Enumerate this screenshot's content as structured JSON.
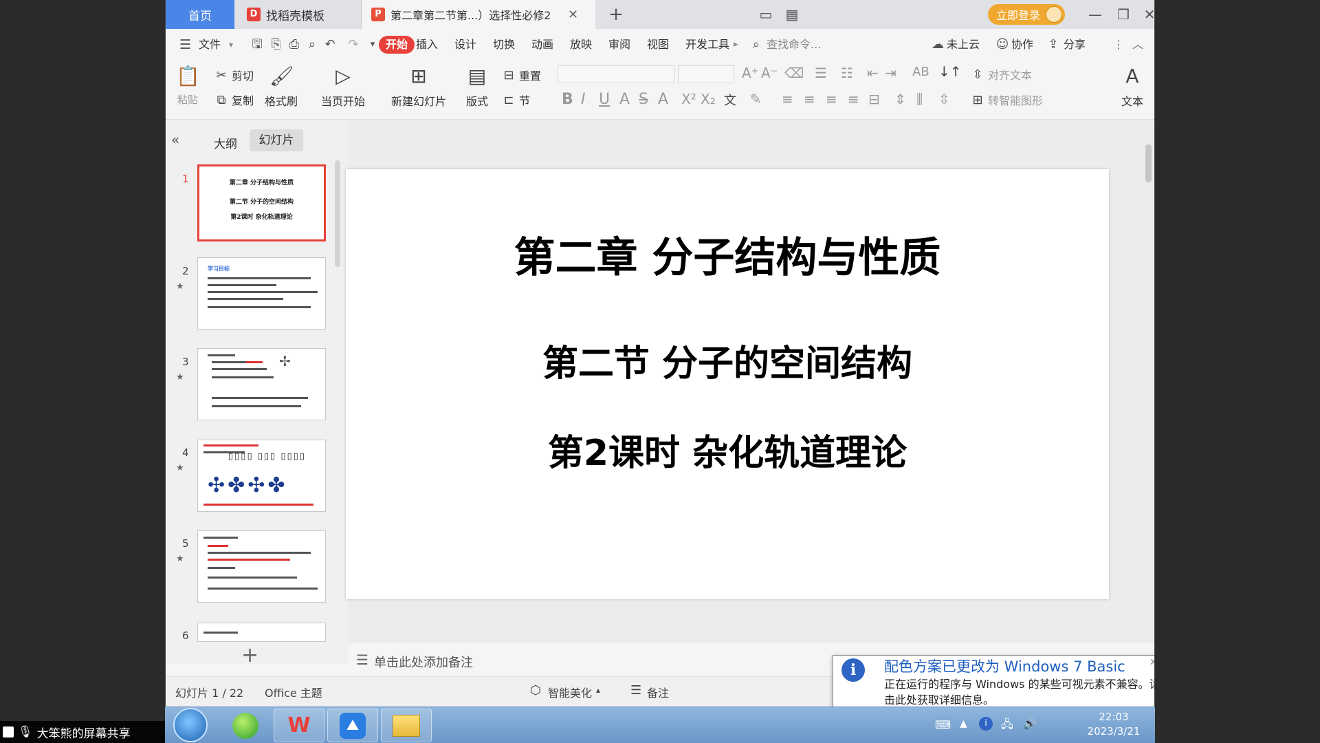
{
  "titlebar": {
    "tab_home": "首页",
    "tab_daoke": "找稻壳模板",
    "tab_doc": "第二章第二节第...）选择性必修2",
    "login": "立即登录"
  },
  "menubar": {
    "file": "文件",
    "items": [
      "开始",
      "插入",
      "设计",
      "切换",
      "动画",
      "放映",
      "审阅",
      "视图",
      "开发工具"
    ],
    "search": "查找命令...",
    "cloud": "未上云",
    "collab": "协作",
    "share": "分享"
  },
  "ribbon": {
    "paste": "粘贴",
    "cut": "剪切",
    "copy": "复制",
    "format_painter": "格式刷",
    "play_from_current": "当页开始",
    "new_slide": "新建幻灯片",
    "layout": "版式",
    "reset": "重置",
    "section": "节",
    "align_text": "对齐文本",
    "convert_shape": "转智能图形",
    "text": "文本"
  },
  "leftpanel": {
    "tab_outline": "大纲",
    "tab_slides": "幻灯片",
    "thumb1_lines": [
      "第二章 分子结构与性质",
      "第二节 分子的空间结构",
      "第2课时 杂化轨道理论"
    ],
    "thumb2_heading": "学习目标",
    "slide_numbers": [
      "1",
      "2",
      "3",
      "4",
      "5",
      "6"
    ]
  },
  "slide": {
    "line1": "第二章  分子结构与性质",
    "line2": "第二节  分子的空间结构",
    "line3": "第2课时  杂化轨道理论"
  },
  "notes": {
    "placeholder": "单击此处添加备注"
  },
  "statusbar": {
    "slide_pos": "幻灯片 1 / 22",
    "theme": "Office 主题",
    "smart": "智能美化",
    "notes": "备注"
  },
  "notification": {
    "title": "配色方案已更改为 Windows 7 Basic",
    "body": "正在运行的程序与 Windows 的某些可视元素不兼容。请单击此处获取详细信息。"
  },
  "taskbar": {
    "time": "22:03",
    "date": "2023/3/21"
  },
  "share_overlay": {
    "label": "大笨熊的屏幕共享"
  },
  "colors": {
    "accent": "#e8403a",
    "tab_home": "#4a86e8",
    "login": "#f0a830"
  }
}
